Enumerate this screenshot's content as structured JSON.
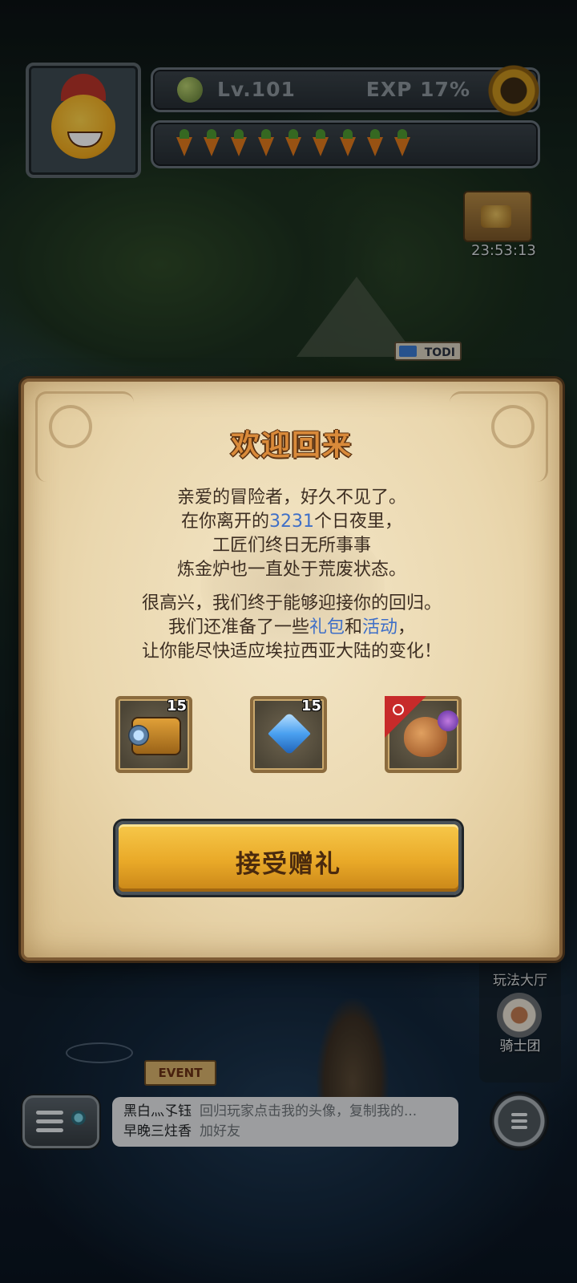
{
  "hud": {
    "level": "Lv.101",
    "exp": "EXP 17%",
    "carrot_count": 9,
    "chest_timer": "23:53:13",
    "todo_sign": "TODI"
  },
  "dialog": {
    "title": "欢迎回来",
    "paragraph1": {
      "line1": "亲爱的冒险者，好久不见了。",
      "line2_pre": "在你离开的",
      "line2_days": "3231",
      "line2_post": "个日夜里，",
      "line3": "工匠们终日无所事事",
      "line4": "炼金炉也一直处于荒废状态。"
    },
    "paragraph2": {
      "line1": "很高兴，我们终于能够迎接你的回归。",
      "line2_pre": "我们还准备了一些",
      "line2_link1": "礼包",
      "line2_mid": "和",
      "line2_link2": "活动",
      "line2_post": "，",
      "line3": "让你能尽快适应埃拉西亚大陆的变化！"
    },
    "gifts": [
      {
        "icon": "camera-icon",
        "count": "15"
      },
      {
        "icon": "crystal-icon",
        "count": "15"
      },
      {
        "icon": "dragon-icon",
        "count": ""
      }
    ],
    "accept_button": "接受赠礼",
    "highlight_color": "#3f6fc7"
  },
  "bottom": {
    "event_sign": "EVENT",
    "dock": {
      "hall_label": "玩法大厅",
      "knight_label": "骑士团"
    },
    "chat": {
      "line1_name": "黑白灬孓钰",
      "line1_msg": "回归玩家点击我的头像，复制我的...",
      "line2_name": "早晚三炷香",
      "line2_msg": "加好友"
    }
  }
}
